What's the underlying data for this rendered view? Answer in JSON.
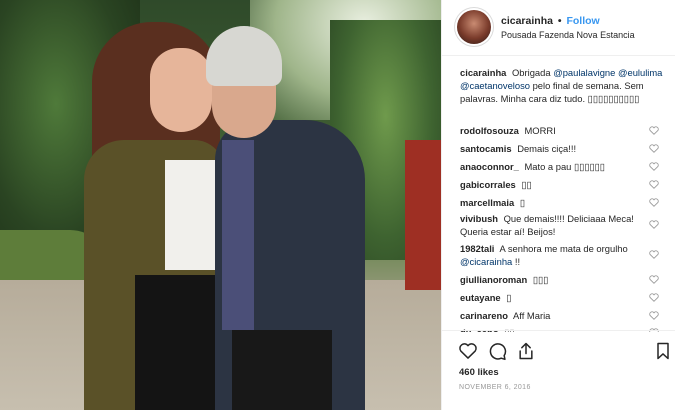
{
  "post": {
    "username": "cicarainha",
    "separator": "•",
    "follow_label": "Follow",
    "location": "Pousada Fazenda Nova Estancia",
    "likes": "460 likes",
    "date": "NOVEMBER 6, 2016"
  },
  "caption": {
    "username": "cicarainha",
    "text_1": "Obrigada",
    "mention_1": "@paulalavigne",
    "mention_2": "@eululima",
    "mention_3": "@caetanoveloso",
    "text_2": "pelo final de semana. Sem palavras. Minha cara diz tudo. ▯▯▯▯▯▯▯▯▯▯"
  },
  "comments": [
    {
      "username": "rodolfosouza",
      "text": "MORRI"
    },
    {
      "username": "santocamis",
      "text": "Demais ciça!!!"
    },
    {
      "username": "anaoconnor_",
      "text": "Mato a pau ▯▯▯▯▯▯"
    },
    {
      "username": "gabicorrales",
      "text": "▯▯"
    },
    {
      "username": "marcellmaia",
      "text": "▯"
    },
    {
      "username": "vivibush",
      "text": "Que demais!!!! Deliciaaa Meca! Queria estar aí! Beijos!"
    },
    {
      "username": "1982tali",
      "text_1": "A senhora me mata de orgulho",
      "mention": "@cicarainha",
      "text_2": "!!"
    },
    {
      "username": "giullianoroman",
      "text": "▯▯▯"
    },
    {
      "username": "eutayane",
      "text": "▯"
    },
    {
      "username": "carinareno",
      "text": "Aff Maria"
    },
    {
      "username": "du_cano",
      "text": "▯▯"
    }
  ],
  "icons": {
    "like": "heart-outline-icon",
    "comment": "speech-bubble-icon",
    "share": "share-arrow-icon",
    "save": "bookmark-icon",
    "comment_like": "small-heart-icon"
  },
  "colors": {
    "link": "#003569",
    "follow": "#3897f0",
    "text": "#262626",
    "muted": "#999999",
    "divider": "#efefef"
  }
}
